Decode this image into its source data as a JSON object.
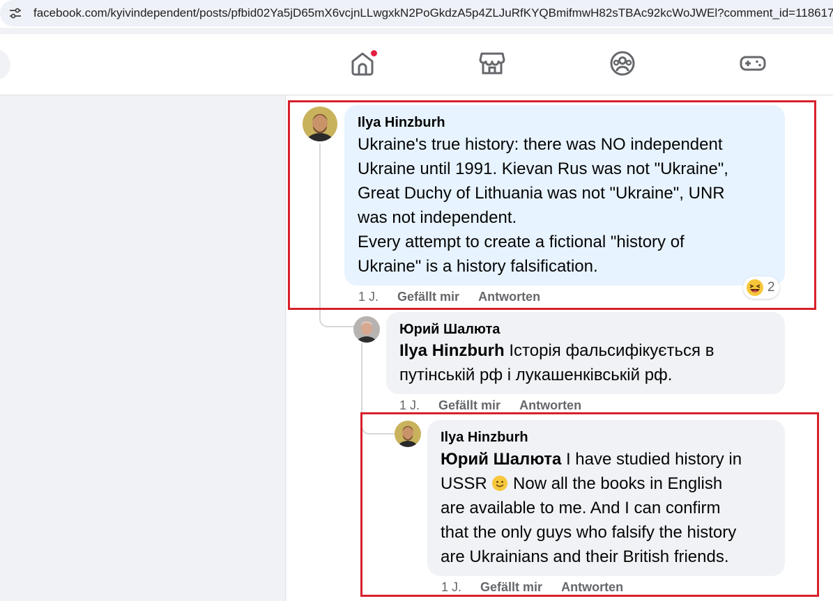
{
  "browser": {
    "url": "facebook.com/kyivindependent/posts/pfbid02Ya5jD65mX6vcjnLLwgxkN2PoGkdzA5p4ZLJuRfKYQBmifmwH82sTBAc92kcWoJWEl?comment_id=118617"
  },
  "nav": {
    "icons": [
      "home-icon",
      "marketplace-icon",
      "groups-icon",
      "gaming-icon"
    ],
    "home_has_notification": true
  },
  "colors": {
    "highlighted_bubble": "#e7f3ff",
    "bubble": "#f0f2f5",
    "highlight_box": "#d7202a",
    "notification": "#e41e3f"
  },
  "comments": [
    {
      "author": "Ilya Hinzburh",
      "lines": [
        "Ukraine's true history: there was NO independent",
        "Ukraine until 1991. Kievan Rus was not \"Ukraine\",",
        "Great Duchy of Lithuania was not \"Ukraine\", UNR",
        "was not independent.",
        "Every attempt to create a fictional \"history of",
        "Ukraine\" is a history falsification."
      ],
      "time": "1 J.",
      "like": "Gefällt mir",
      "reply": "Antworten",
      "reaction_icon": "laughing-face-emoji",
      "reaction_count": "2"
    },
    {
      "author": "Юрий Шалюта",
      "mention": "Ilya Hinzburh",
      "line1_rest": " Історія фальсифікується в",
      "line2": "путінській рф і лукашенківській рф.",
      "time": "1 J.",
      "like": "Gefällt mir",
      "reply": "Antworten"
    },
    {
      "author": "Ilya Hinzburh",
      "mention": "Юрий Шалюта",
      "line1_rest": " I have studied history in",
      "line2_start": "USSR ",
      "line2_emoji": "slightly-smiling-face-emoji",
      "line2_rest": " Now all the books in English",
      "lines_after": [
        "are available to me. And I can confirm",
        "that the only guys who falsify the history",
        "are Ukrainians and their British friends."
      ],
      "time": "1 J.",
      "like": "Gefällt mir",
      "reply": "Antworten"
    }
  ]
}
